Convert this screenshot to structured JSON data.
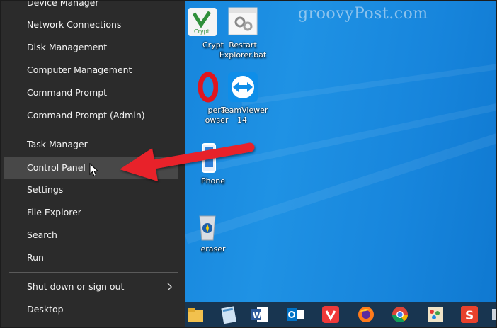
{
  "watermark": "groovyPost.com",
  "menu": {
    "items": [
      {
        "label": "Device Manager"
      },
      {
        "label": "Network Connections"
      },
      {
        "label": "Disk Management"
      },
      {
        "label": "Computer Management"
      },
      {
        "label": "Command Prompt"
      },
      {
        "label": "Command Prompt (Admin)"
      },
      {
        "label": "Task Manager"
      },
      {
        "label": "Control Panel"
      },
      {
        "label": "Settings"
      },
      {
        "label": "File Explorer"
      },
      {
        "label": "Search"
      },
      {
        "label": "Run"
      },
      {
        "label": "Shut down or sign out"
      },
      {
        "label": "Desktop"
      }
    ],
    "highlighted": "Control Panel"
  },
  "desktop_icons": [
    {
      "label": "Crypt",
      "icon": "veracrypt-icon"
    },
    {
      "label": "Restart Explorer.bat",
      "icon": "batch-file-icon"
    },
    {
      "label": "pera owser",
      "icon": "opera-icon"
    },
    {
      "label": "TeamViewer 14",
      "icon": "teamviewer-icon"
    },
    {
      "label": "Phone",
      "icon": "phone-icon"
    },
    {
      "label": "eraser",
      "icon": "eraser-icon"
    }
  ],
  "taskbar_icons": [
    "file-explorer-icon",
    "notepad-icon",
    "word-icon",
    "outlook-icon",
    "vivaldi-icon",
    "firefox-icon",
    "chrome-icon",
    "paint-icon",
    "snagit-icon"
  ],
  "colors": {
    "menu_bg": "#2b2b2b",
    "menu_highlight": "#484848",
    "desktop_blue": "#1584dc",
    "arrow_red": "#e8202a"
  }
}
